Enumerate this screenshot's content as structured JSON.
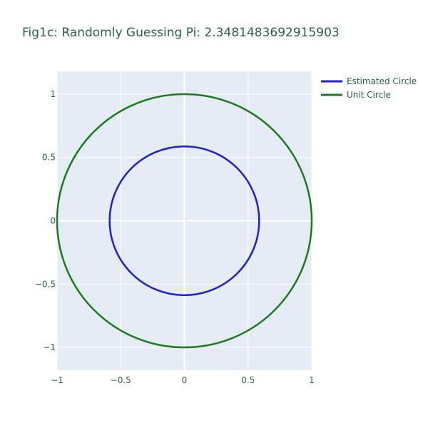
{
  "chart_data": {
    "type": "line",
    "title": "Fig1c: Randomly Guessing Pi: 2.3481483692915903",
    "xlabel": "",
    "ylabel": "",
    "xlim": [
      -1,
      1
    ],
    "ylim": [
      -1.18,
      1.18
    ],
    "x_ticks": [
      -1,
      -0.5,
      0,
      0.5,
      1
    ],
    "x_tick_labels": [
      "−1",
      "−0.5",
      "0",
      "0.5",
      "1"
    ],
    "y_ticks": [
      -1,
      -0.5,
      0,
      0.5,
      1
    ],
    "y_tick_labels": [
      "−1",
      "−0.5",
      "0",
      "0.5",
      "1"
    ],
    "grid": true,
    "legend_position": "top-right",
    "series": [
      {
        "name": "Estimated Circle",
        "shape": "circle",
        "center": [
          0,
          0
        ],
        "radius": 0.5871,
        "color": "#1f1fd6"
      },
      {
        "name": "Unit Circle",
        "shape": "circle",
        "center": [
          0,
          0
        ],
        "radius": 1.0,
        "color": "#1e7a1e"
      }
    ]
  },
  "colors": {
    "plot_background": "#e5ecf6",
    "grid": "#ffffff",
    "text": "#2a5f4f"
  }
}
